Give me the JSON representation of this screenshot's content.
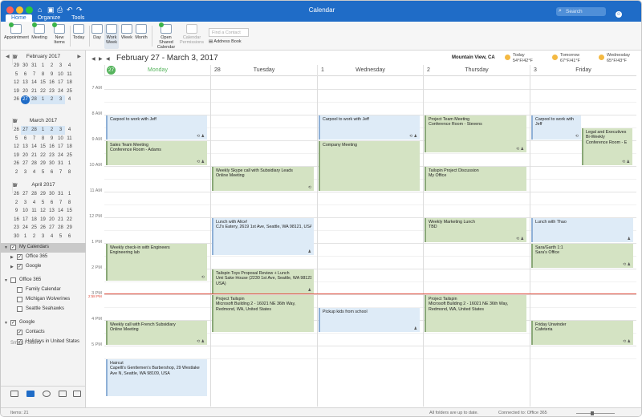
{
  "window": {
    "title": "Calendar",
    "tabs": [
      "Home",
      "Organize",
      "Tools"
    ],
    "search_placeholder": "Search"
  },
  "ribbon": {
    "appointment": "Appointment",
    "meeting": "Meeting",
    "new_items": "New Items",
    "today": "Today",
    "day": "Day",
    "work_week": "Work Week",
    "week": "Week",
    "month": "Month",
    "open_shared": "Open Shared Calendar",
    "cal_permissions": "Calendar Permissions",
    "find_contact": "Find a Contact",
    "address_book": "Address Book"
  },
  "mini_calendars": [
    {
      "title": "February 2017",
      "days_header": [
        "S",
        "M",
        "T",
        "W",
        "T",
        "F",
        "S"
      ],
      "rows": [
        [
          "29",
          "30",
          "31",
          "1",
          "2",
          "3",
          "4"
        ],
        [
          "5",
          "6",
          "7",
          "8",
          "9",
          "10",
          "11"
        ],
        [
          "12",
          "13",
          "14",
          "15",
          "16",
          "17",
          "18"
        ],
        [
          "19",
          "20",
          "21",
          "22",
          "23",
          "24",
          "25"
        ],
        [
          "26",
          "27",
          "28",
          "1",
          "2",
          "3",
          "4"
        ]
      ],
      "today": "27"
    },
    {
      "title": "March 2017",
      "days_header": [
        "S",
        "M",
        "T",
        "W",
        "T",
        "F",
        "S"
      ],
      "rows": [
        [
          "26",
          "27",
          "28",
          "1",
          "2",
          "3",
          "4"
        ],
        [
          "5",
          "6",
          "7",
          "8",
          "9",
          "10",
          "11"
        ],
        [
          "12",
          "13",
          "14",
          "15",
          "16",
          "17",
          "18"
        ],
        [
          "19",
          "20",
          "21",
          "22",
          "23",
          "24",
          "25"
        ],
        [
          "26",
          "27",
          "28",
          "29",
          "30",
          "31",
          "1"
        ],
        [
          "2",
          "3",
          "4",
          "5",
          "6",
          "7",
          "8"
        ]
      ]
    },
    {
      "title": "April 2017",
      "days_header": [
        "S",
        "M",
        "T",
        "W",
        "T",
        "F",
        "S"
      ],
      "rows": [
        [
          "26",
          "27",
          "28",
          "29",
          "30",
          "31",
          "1"
        ],
        [
          "2",
          "3",
          "4",
          "5",
          "6",
          "7",
          "8"
        ],
        [
          "9",
          "10",
          "11",
          "12",
          "13",
          "14",
          "15"
        ],
        [
          "16",
          "17",
          "18",
          "19",
          "20",
          "21",
          "22"
        ],
        [
          "23",
          "24",
          "25",
          "26",
          "27",
          "28",
          "29"
        ],
        [
          "30",
          "1",
          "2",
          "3",
          "4",
          "5",
          "6"
        ]
      ]
    }
  ],
  "calendars": [
    {
      "label": "My Calendars",
      "level": 0,
      "expanded": true,
      "checked": true,
      "selected": true
    },
    {
      "label": "Office 365",
      "level": 1,
      "expanded": false,
      "checked": true
    },
    {
      "label": "Google",
      "level": 1,
      "expanded": false,
      "checked": true
    },
    {
      "label": "Office 365",
      "level": 0,
      "expanded": true,
      "checked": false
    },
    {
      "label": "Family Calendar",
      "level": 1,
      "checked": false
    },
    {
      "label": "Michigan Wolverines",
      "level": 1,
      "checked": false
    },
    {
      "label": "Seattle Seahawks",
      "level": 1,
      "checked": false
    },
    {
      "label": "Google",
      "level": 0,
      "expanded": true,
      "checked": true
    },
    {
      "label": "Contacts",
      "level": 1,
      "checked": true
    },
    {
      "label": "Holidays in United States",
      "level": 1,
      "checked": true
    }
  ],
  "smart_folders": "Smart Folders",
  "header": {
    "date_range": "February 27 - March 3, 2017",
    "location": "Mountain View, CA",
    "weather": [
      {
        "day": "Today",
        "temp": "54°F/42°F"
      },
      {
        "day": "Tomorrow",
        "temp": "67°F/41°F"
      },
      {
        "day": "Wednesday",
        "temp": "65°F/43°F"
      }
    ]
  },
  "days": [
    {
      "num": "27",
      "name": "Monday",
      "today": true
    },
    {
      "num": "28",
      "name": "Tuesday"
    },
    {
      "num": "1",
      "name": "Wednesday"
    },
    {
      "num": "2",
      "name": "Thursday"
    },
    {
      "num": "3",
      "name": "Friday"
    }
  ],
  "hours": [
    "7 AM",
    "8 AM",
    "9 AM",
    "10 AM",
    "11 AM",
    "12 PM",
    "1 PM",
    "2 PM",
    "3 PM",
    "4 PM",
    "5 PM"
  ],
  "now_label": "2:58 PM",
  "now_hour": 14.97,
  "events": [
    {
      "day": 0,
      "start": 8.0,
      "end": 9.0,
      "title": "Carpool to work with Jeff",
      "sub": "",
      "color": "blue",
      "badge": "⟲ ♟"
    },
    {
      "day": 0,
      "start": 9.0,
      "end": 10.0,
      "title": "Sales Team Meeting",
      "sub": "Conference Room - Adams",
      "color": "green",
      "badge": "⟲ ♟"
    },
    {
      "day": 0,
      "start": 13.0,
      "end": 14.5,
      "title": "Weekly check-in with Engineers",
      "sub": "Engineering lab",
      "color": "green",
      "badge": "⟲"
    },
    {
      "day": 0,
      "start": 16.0,
      "end": 17.0,
      "title": "Weekly call with French Subsidiary",
      "sub": "Online Meeting",
      "color": "green",
      "badge": "⟲ ♟"
    },
    {
      "day": 0,
      "start": 17.5,
      "end": 19.0,
      "title": "Haircut",
      "sub": "Capelli's Gentlemen's Barbershop, 29 Westlake",
      "sub2": "Ave N, Seattle, WA 98109, USA",
      "color": "blue",
      "badge": ""
    },
    {
      "day": 1,
      "start": 10.0,
      "end": 11.0,
      "title": "Weekly Skype call with Subsidiary Leads",
      "sub": "Online Meeting",
      "color": "green",
      "badge": "⟲"
    },
    {
      "day": 1,
      "start": 12.0,
      "end": 13.5,
      "title": "Lunch with Alice!",
      "sub": "CJ's Eatery, 2619 1st Ave, Seattle, WA 98121, USA",
      "color": "blue",
      "badge": "♟"
    },
    {
      "day": 1,
      "start": 14.0,
      "end": 15.0,
      "title": "Tailspin Toys Proposal Review + Lunch",
      "sub": "Umi Sake House (2230 1st Ave, Seattle, WA 98121",
      "sub2": "USA)",
      "color": "green",
      "badge": "♟"
    },
    {
      "day": 1,
      "start": 15.0,
      "end": 16.5,
      "title": "Project Tailspin",
      "sub": "Microsoft Building 2 - 16021 NE 36th Way,",
      "sub2": "Redmond, WA, United States",
      "color": "green",
      "badge": ""
    },
    {
      "day": 2,
      "start": 8.0,
      "end": 9.0,
      "title": "Carpool to work with Jeff",
      "sub": "",
      "color": "blue",
      "badge": "⟲ ♟"
    },
    {
      "day": 2,
      "start": 9.0,
      "end": 11.0,
      "title": "Company Meeting",
      "sub": "",
      "color": "green",
      "badge": ""
    },
    {
      "day": 2,
      "start": 15.5,
      "end": 16.5,
      "title": "Pickup kids from school",
      "sub": "",
      "color": "blue",
      "badge": "♟"
    },
    {
      "day": 3,
      "start": 8.0,
      "end": 9.5,
      "title": "Project Team Meeting",
      "sub": "Conference Room - Stevens",
      "color": "green",
      "badge": "⟲ ♟"
    },
    {
      "day": 3,
      "start": 10.0,
      "end": 11.0,
      "title": "Tailspin Project Discussion",
      "sub": "My Office",
      "color": "green",
      "badge": ""
    },
    {
      "day": 3,
      "start": 12.0,
      "end": 13.0,
      "title": "Weekly Marketing Lunch",
      "sub": "TBD",
      "color": "green",
      "badge": "⟲ ♟"
    },
    {
      "day": 3,
      "start": 15.0,
      "end": 16.5,
      "title": "Project Tailspin",
      "sub": "Microsoft Building 2 - 16021 NE 36th Way,",
      "sub2": "Redmond, WA, United States",
      "color": "green",
      "badge": ""
    },
    {
      "day": 4,
      "start": 8.0,
      "end": 9.0,
      "title": "Carpool to work with",
      "sub": "Jeff",
      "color": "blue",
      "badge": "⟲"
    },
    {
      "day": 4,
      "start": 8.5,
      "end": 10.0,
      "title": "Legal and Executives",
      "sub": "Bi-Weekly",
      "sub2": "Conference Room - E",
      "color": "green",
      "badge": "⟲ ♟",
      "half": true
    },
    {
      "day": 4,
      "start": 12.0,
      "end": 13.0,
      "title": "Lunch with Thao",
      "sub": "",
      "color": "blue",
      "badge": "♟"
    },
    {
      "day": 4,
      "start": 13.0,
      "end": 14.0,
      "title": "Sara/Garth 1:1",
      "sub": "Sara's Office",
      "color": "green",
      "badge": "⟲ ♟"
    },
    {
      "day": 4,
      "start": 16.0,
      "end": 17.0,
      "title": "Friday Unwinder",
      "sub": "Cafeteria",
      "color": "green",
      "badge": "⟲ ♟"
    }
  ],
  "status": {
    "items": "Items: 21",
    "sync": "All folders are up to date.",
    "connected": "Connected to: Office 365"
  }
}
